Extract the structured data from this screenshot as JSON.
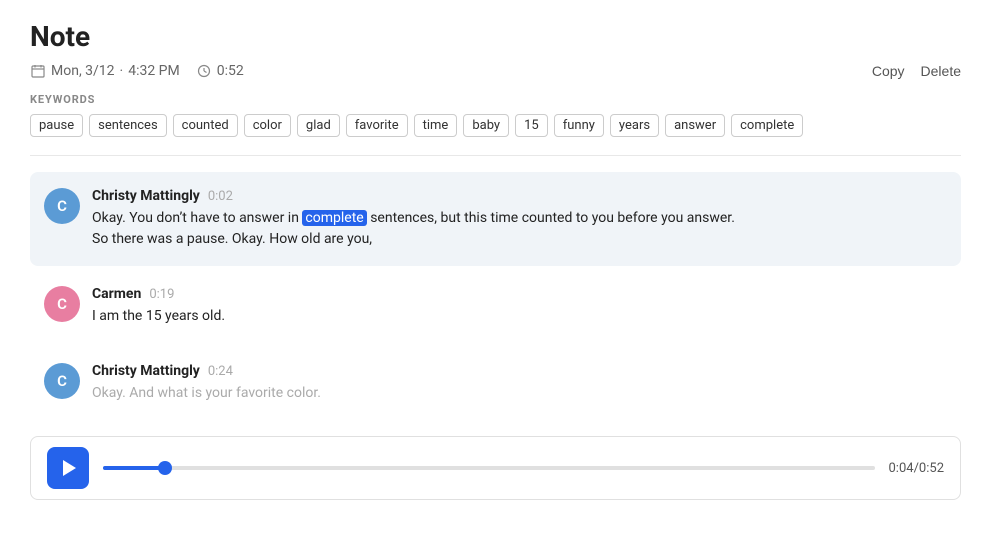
{
  "page": {
    "title": "Note"
  },
  "meta": {
    "date": "Mon, 3/12",
    "time": "4:32 PM",
    "duration": "0:52",
    "copy_label": "Copy",
    "delete_label": "Delete"
  },
  "keywords": {
    "label": "KEYWORDS",
    "items": [
      "pause",
      "sentences",
      "counted",
      "color",
      "glad",
      "favorite",
      "time",
      "baby",
      "15",
      "funny",
      "years",
      "answer",
      "complete"
    ]
  },
  "messages": [
    {
      "speaker": "Christy Mattingly",
      "avatar_letter": "C",
      "avatar_style": "blue",
      "timestamp": "0:02",
      "text_before": "Okay. You don’t have to answer in ",
      "highlight": "complete",
      "text_after": " sentences, but this time counted to you before you answer.",
      "text_line2": "So there was a pause. Okay. How old are you,",
      "highlighted": true,
      "faded": false
    },
    {
      "speaker": "Carmen",
      "avatar_letter": "C",
      "avatar_style": "pink",
      "timestamp": "0:19",
      "text": "I am the 15 years old.",
      "highlighted": false,
      "faded": false
    },
    {
      "speaker": "Christy Mattingly",
      "avatar_letter": "C",
      "avatar_style": "blue",
      "timestamp": "0:24",
      "text": "Okay. And what is your favorite color.",
      "highlighted": false,
      "faded": true
    }
  ],
  "audio": {
    "current_time": "0:04",
    "total_time": "0:52",
    "progress_percent": 8
  }
}
